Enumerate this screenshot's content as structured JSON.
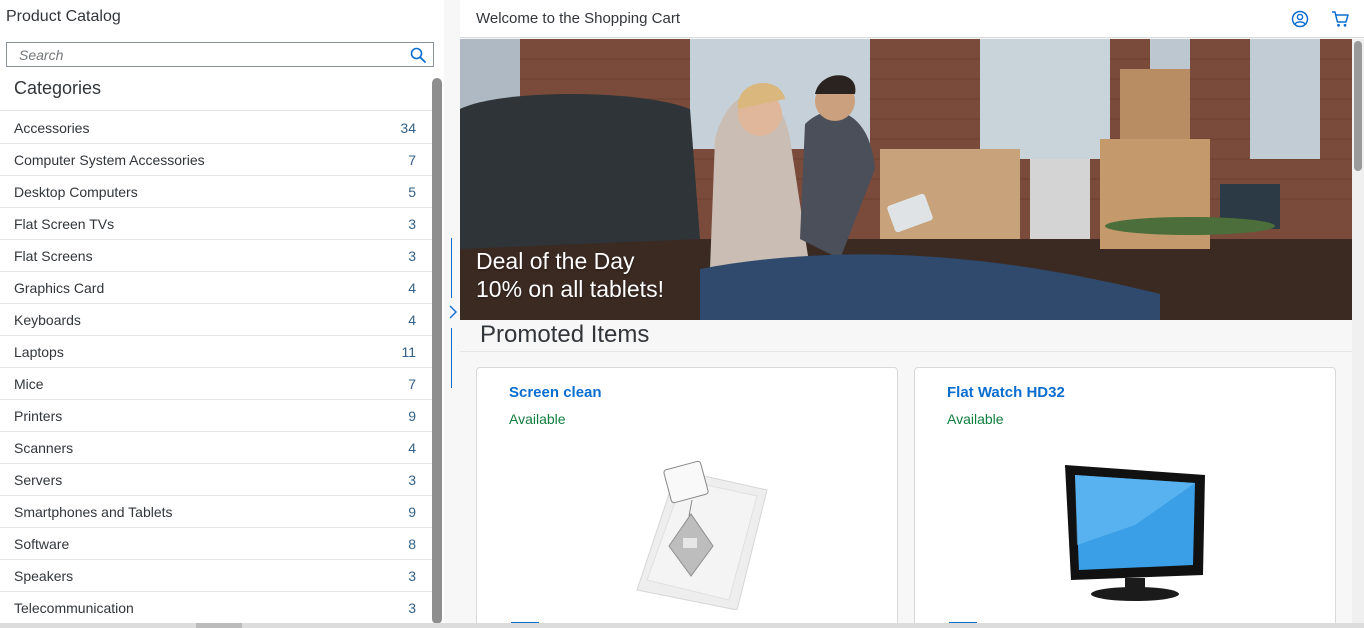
{
  "master": {
    "title": "Product Catalog",
    "search_placeholder": "Search",
    "categories_header": "Categories",
    "categories": [
      {
        "name": "Accessories",
        "count": "34"
      },
      {
        "name": "Computer System Accessories",
        "count": "7"
      },
      {
        "name": "Desktop Computers",
        "count": "5"
      },
      {
        "name": "Flat Screen TVs",
        "count": "3"
      },
      {
        "name": "Flat Screens",
        "count": "3"
      },
      {
        "name": "Graphics Card",
        "count": "4"
      },
      {
        "name": "Keyboards",
        "count": "4"
      },
      {
        "name": "Laptops",
        "count": "11"
      },
      {
        "name": "Mice",
        "count": "7"
      },
      {
        "name": "Printers",
        "count": "9"
      },
      {
        "name": "Scanners",
        "count": "4"
      },
      {
        "name": "Servers",
        "count": "3"
      },
      {
        "name": "Smartphones and Tablets",
        "count": "9"
      },
      {
        "name": "Software",
        "count": "8"
      },
      {
        "name": "Speakers",
        "count": "3"
      },
      {
        "name": "Telecommunication",
        "count": "3"
      }
    ]
  },
  "detail": {
    "title": "Welcome to the Shopping Cart",
    "hero_caption_line1": "Deal of the Day",
    "hero_caption_line2": "10% on all tablets!",
    "promoted_title": "Promoted Items",
    "cards": [
      {
        "name": "Screen clean",
        "status": "Available",
        "image": "screen-cleaner-image"
      },
      {
        "name": "Flat Watch HD32",
        "status": "Available",
        "image": "monitor-image"
      }
    ]
  },
  "icons": {
    "search": "search-icon",
    "account": "user-account-icon",
    "cart": "shopping-cart-icon",
    "splitter": "chevron-right-icon"
  },
  "colors": {
    "accent": "#0a6ed1",
    "available": "#107e3e",
    "count": "#346187"
  }
}
